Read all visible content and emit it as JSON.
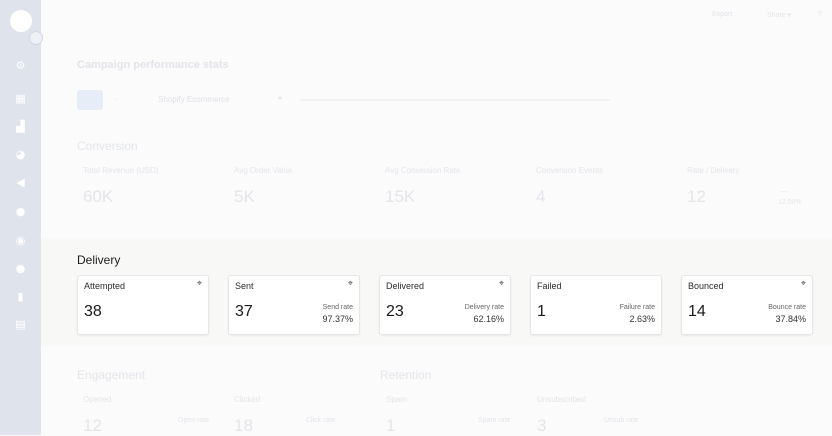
{
  "sidebar": {
    "icons": [
      "gear-icon",
      "dashboard-icon",
      "analytics-icon",
      "pie-chart-icon",
      "megaphone-icon",
      "dot-icon",
      "user-icon",
      "chat-icon",
      "document-icon",
      "gallery-icon"
    ],
    "glyphs": [
      "⚙",
      "▦",
      "▟",
      "◕",
      "◀",
      "●",
      "◉",
      "●",
      "▮",
      "▤"
    ]
  },
  "topbar": {
    "link1": "Export",
    "link2": "Share ▾",
    "help": "?"
  },
  "page": {
    "title": "Campaign performance stats",
    "filter_icon": "≡",
    "filter_dot": "◦",
    "filter_select": "Shopify Ecommerce",
    "filter_caret": "▾"
  },
  "conversion": {
    "title": "Conversion",
    "metrics": [
      {
        "label": "Total Revenue (USD)",
        "value": "60K"
      },
      {
        "label": "Avg Order Value",
        "value": "5K"
      },
      {
        "label": "Avg Conversion Rate",
        "value": "15K"
      },
      {
        "label": "Conversion Events",
        "value": "4"
      },
      {
        "label": "Rate / Delivery",
        "value": "12",
        "sub": "—",
        "sub2": "12.00%"
      }
    ]
  },
  "delivery": {
    "title": "Delivery",
    "cards": [
      {
        "label": "Attempted",
        "value": "38",
        "sublabel": "",
        "subvalue": ""
      },
      {
        "label": "Sent",
        "value": "37",
        "sublabel": "Send rate",
        "subvalue": "97.37%"
      },
      {
        "label": "Delivered",
        "value": "23",
        "sublabel": "Delivery rate",
        "subvalue": "62.16%"
      },
      {
        "label": "Failed",
        "value": "1",
        "sublabel": "Failure rate",
        "subvalue": "2.63%"
      },
      {
        "label": "Bounced",
        "value": "14",
        "sublabel": "Bounce rate",
        "subvalue": "37.84%"
      }
    ],
    "pin_glyph": "📌"
  },
  "engagement": {
    "title": "Engagement",
    "metrics": [
      {
        "label": "Opened",
        "value": "12",
        "sub": "Open rate",
        "sub2": "32.43%"
      },
      {
        "label": "Clicked",
        "value": "18",
        "sub": "Click rate",
        "sub2": "48.65%"
      }
    ]
  },
  "retention": {
    "title": "Retention",
    "metrics": [
      {
        "label": "Spam",
        "value": "1",
        "sub": "Spam rate",
        "sub2": "2.70%"
      },
      {
        "label": "Unsubscribed",
        "value": "3",
        "sub": "Unsub rate",
        "sub2": "8.11%"
      }
    ]
  }
}
